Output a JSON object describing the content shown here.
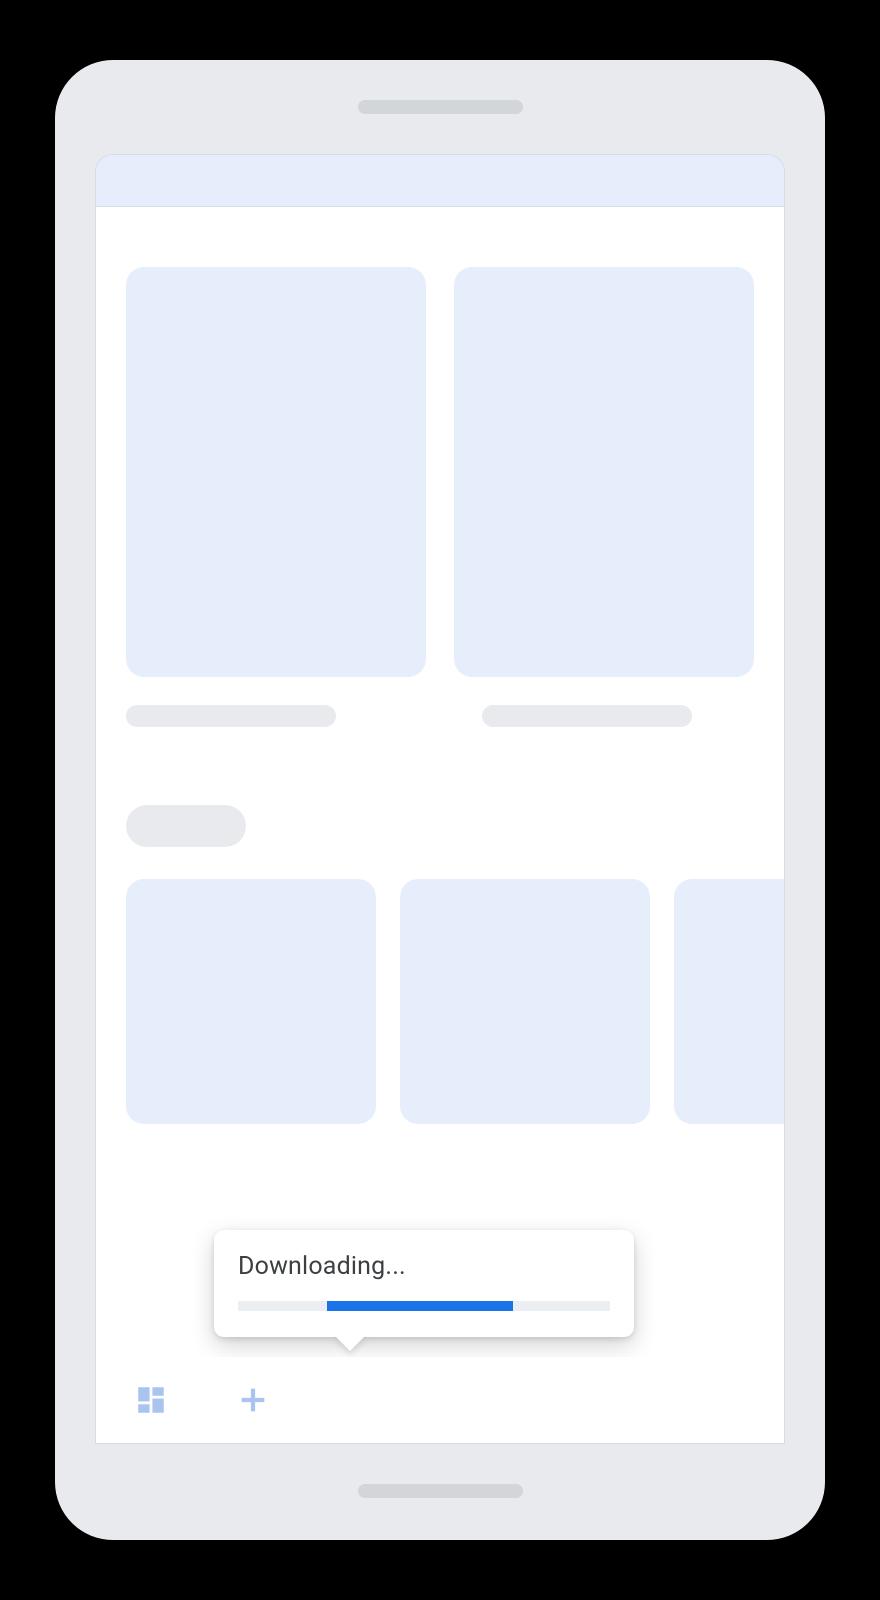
{
  "tooltip": {
    "label": "Downloading...",
    "progress_indeterminate": true
  },
  "colors": {
    "accent": "#1a73e8",
    "surface_variant": "#e6edfb",
    "nav_icon": "#aac3ef"
  }
}
